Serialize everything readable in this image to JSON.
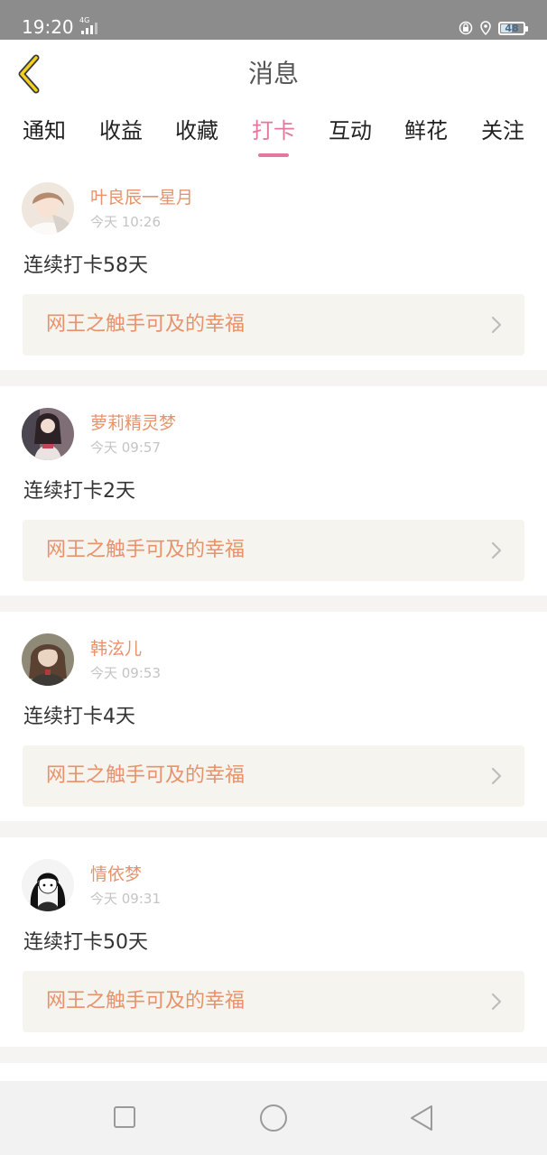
{
  "status": {
    "time": "19:20",
    "network": "4G",
    "battery": "48",
    "battery_level": 0.48
  },
  "header": {
    "title": "消息",
    "back_icon": "chevron-left-icon"
  },
  "tabs": [
    {
      "label": "通知",
      "active": false
    },
    {
      "label": "收益",
      "active": false
    },
    {
      "label": "收藏",
      "active": false
    },
    {
      "label": "打卡",
      "active": true
    },
    {
      "label": "互动",
      "active": false
    },
    {
      "label": "鲜花",
      "active": false
    },
    {
      "label": "关注",
      "active": false
    }
  ],
  "messages": [
    {
      "user": "叶良辰一星月",
      "time": "今天 10:26",
      "text": "连续打卡58天",
      "book": "网王之触手可及的幸福"
    },
    {
      "user": "萝莉精灵梦",
      "time": "今天 09:57",
      "text": "连续打卡2天",
      "book": "网王之触手可及的幸福"
    },
    {
      "user": "韩泫儿",
      "time": "今天 09:53",
      "text": "连续打卡4天",
      "book": "网王之触手可及的幸福"
    },
    {
      "user": "情依梦",
      "time": "今天 09:31",
      "text": "连续打卡50天",
      "book": "网王之触手可及的幸福"
    }
  ],
  "colors": {
    "accent": "#e4779d",
    "name": "#e8926b",
    "book_bg": "#f5f4ee"
  }
}
